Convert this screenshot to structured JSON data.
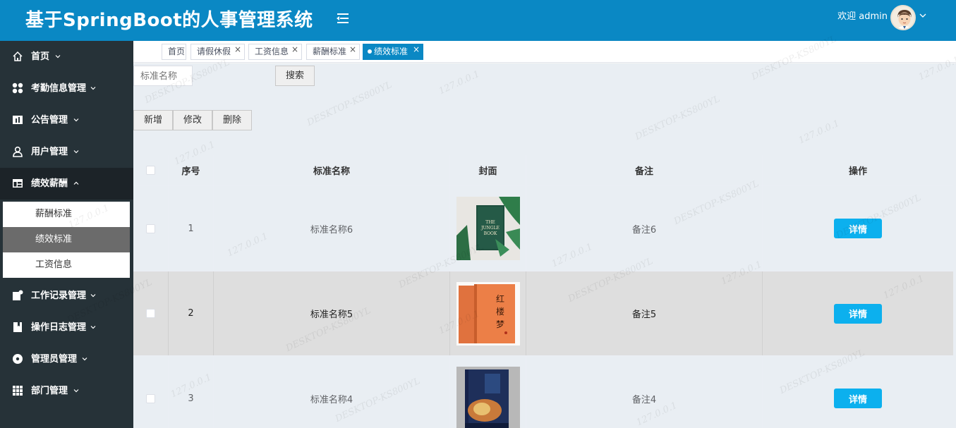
{
  "header": {
    "title": "基于SpringBoot的人事管理系统",
    "welcome": "欢迎 admin"
  },
  "sidebar": {
    "items": [
      {
        "label": "首页",
        "icon": "home-icon"
      },
      {
        "label": "考勤信息管理",
        "icon": "apps-icon"
      },
      {
        "label": "公告管理",
        "icon": "chart-icon"
      },
      {
        "label": "用户管理",
        "icon": "user-icon"
      },
      {
        "label": "绩效薪酬",
        "icon": "table-icon"
      },
      {
        "label": "工作记录管理",
        "icon": "record-icon"
      },
      {
        "label": "操作日志管理",
        "icon": "book-icon"
      },
      {
        "label": "管理员管理",
        "icon": "admin-icon"
      },
      {
        "label": "部门管理",
        "icon": "grid-icon"
      }
    ],
    "submenu": [
      "薪酬标准",
      "绩效标准",
      "工资信息"
    ]
  },
  "tabs": [
    "首页",
    "请假休假",
    "工资信息",
    "薪酬标准",
    "绩效标准"
  ],
  "search": {
    "placeholder": "标准名称",
    "button": "搜索"
  },
  "actions": {
    "add": "新增",
    "edit": "修改",
    "delete": "删除"
  },
  "table": {
    "headers": [
      "序号",
      "标准名称",
      "封面",
      "备注",
      "操作"
    ],
    "rows": [
      {
        "index": "1",
        "name": "标准名称6",
        "remark": "备注6",
        "action": "详情"
      },
      {
        "index": "2",
        "name": "标准名称5",
        "remark": "备注5",
        "action": "详情"
      },
      {
        "index": "3",
        "name": "标准名称4",
        "remark": "备注4",
        "action": "详情"
      }
    ]
  },
  "watermark": {
    "ip": "127.0.0.1",
    "host": "DESKTOP-KS800YL"
  },
  "colors": {
    "brand": "#0a88c4",
    "sidebar": "#263238",
    "detail_button": "#0cb0ee"
  }
}
